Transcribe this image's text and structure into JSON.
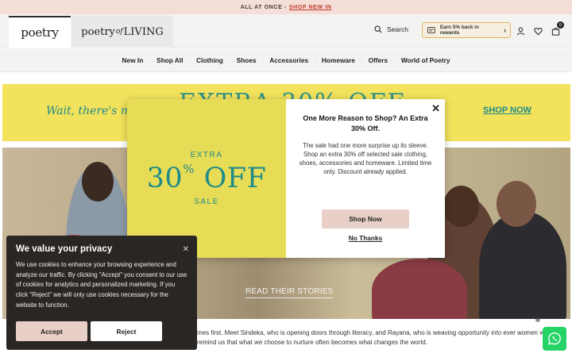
{
  "announcement": {
    "text": "ALL AT ONCE -",
    "link": "SHOP NEW IN"
  },
  "header": {
    "brand_primary": "poetry",
    "brand_secondary_a": "poetry",
    "brand_secondary_of": "of",
    "brand_secondary_b": "LIVING",
    "search_label": "Search",
    "rewards_label": "Earn 5% back in rewards",
    "bag_count": "0"
  },
  "nav": {
    "items": [
      "New In",
      "Shop All",
      "Clothing",
      "Shoes",
      "Accessories",
      "Homeware",
      "Offers",
      "World of Poetry"
    ]
  },
  "promo_banner": {
    "wait_text": "Wait, there's mo",
    "big_text": "EXTRA 30% OFF",
    "shop_now": "SHOP NOW"
  },
  "hero": {
    "read_stories": "READ THEIR STORIES"
  },
  "story": {
    "text": "mes first. Meet Sindeka, who is opening doors through literacy, and Rayana, who is weaving opportunity into ever women who remind us that what we choose to nurture often becomes what changes the world."
  },
  "modal": {
    "extra": "EXTRA",
    "pct": "30",
    "pct_sign": "%",
    "off": "OFF",
    "sale": "SALE",
    "title": "One More Reason to Shop? An Extra 30% Off.",
    "body": "The sale had one more surprise up its sleeve. Shop an extra 30% off selected sale clothing, shoes, accessories and homeware. Limited time only. Discount already applied.",
    "shop_now": "Shop Now",
    "no_thanks": "No Thanks"
  },
  "cookie": {
    "title": "We value your privacy",
    "text": "We use cookies to enhance your browsing experience and analyze our traffic. By clicking \"Accept\" you consent to our use of cookies for analytics and personalized marketing. If you click \"Reject\" we will only use cookies necessary for the website to function.",
    "accept": "Accept",
    "reject": "Reject"
  },
  "colors": {
    "accent_teal": "#1f8a8a",
    "promo_yellow": "#f2e25c",
    "button_pink": "#e8cfc7",
    "whatsapp_green": "#25d366"
  }
}
